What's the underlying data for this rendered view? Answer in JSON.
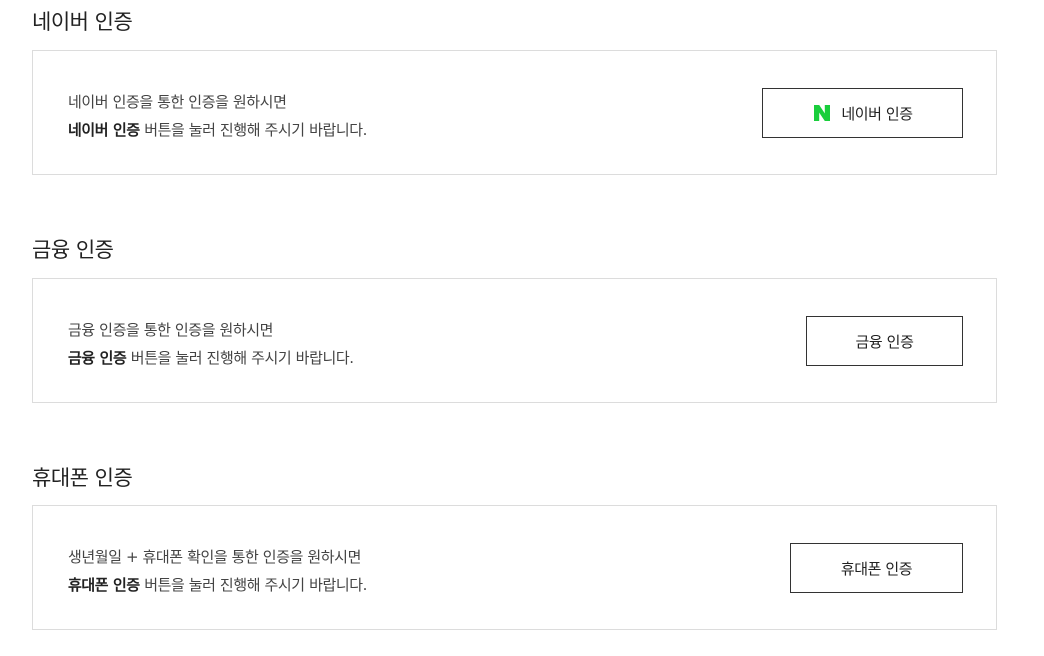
{
  "naver": {
    "title": "네이버 인증",
    "desc_line1": "네이버 인증을 통한 인증을 원하시면",
    "desc_bold": "네이버 인증",
    "desc_rest": " 버튼을 눌러 진행해 주시기 바랍니다.",
    "button_label": "네이버 인증",
    "logo_color": "#19ce3c"
  },
  "finance": {
    "title": "금융 인증",
    "desc_line1": "금융 인증을 통한 인증을 원하시면",
    "desc_bold": "금융 인증",
    "desc_rest": " 버튼을 눌러 진행해 주시기 바랍니다.",
    "button_label": "금융 인증"
  },
  "phone": {
    "title": "휴대폰 인증",
    "desc_line1": "생년월일 + 휴대폰 확인을 통한 인증을 원하시면",
    "desc_bold": "휴대폰 인증",
    "desc_rest": " 버튼을 눌러 진행해 주시기 바랍니다.",
    "button_label": "휴대폰 인증"
  }
}
